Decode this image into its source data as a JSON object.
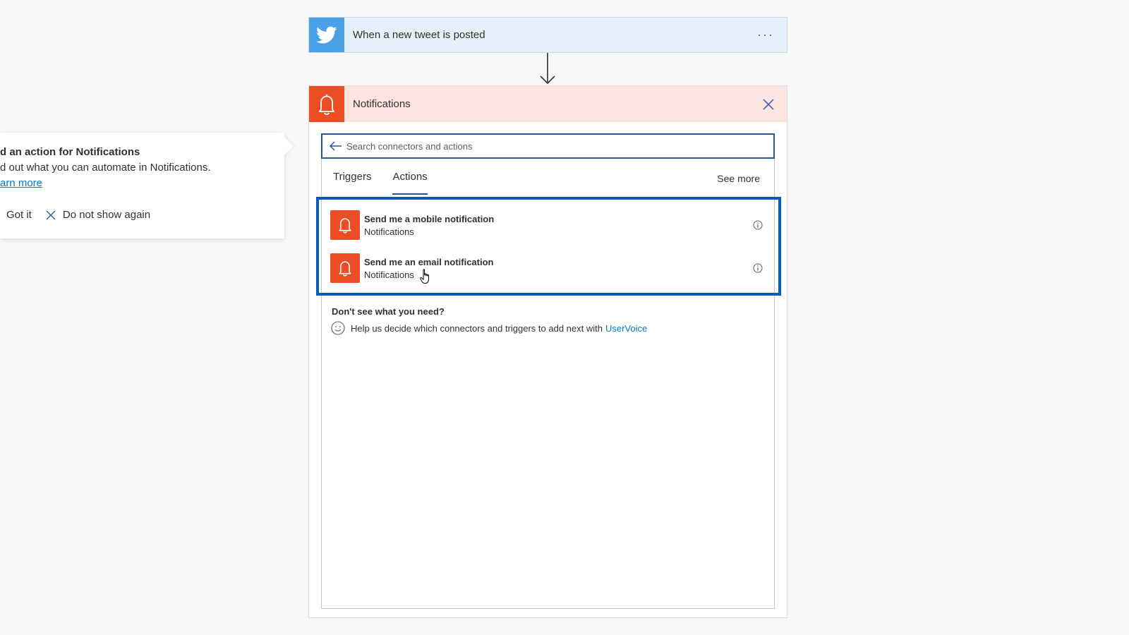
{
  "callout": {
    "title": "d an action for Notifications",
    "body": "d out what you can automate in Notifications.",
    "learn_more": "arn more",
    "got_it": "Got it",
    "do_not_show": "Do not show again"
  },
  "trigger": {
    "title": "When a new tweet is posted",
    "icon": "twitter-bird-icon",
    "more_label": "···"
  },
  "notifications": {
    "title": "Notifications",
    "icon": "bell-icon",
    "search": {
      "placeholder": "Search connectors and actions"
    },
    "tabs": [
      {
        "label": "Triggers",
        "active": false
      },
      {
        "label": "Actions",
        "active": true
      }
    ],
    "see_more": "See more",
    "actions": [
      {
        "title": "Send me a mobile notification",
        "subtitle": "Notifications"
      },
      {
        "title": "Send me an email notification",
        "subtitle": "Notifications"
      }
    ],
    "help": {
      "title": "Don't see what you need?",
      "text": "Help us decide which connectors and triggers to add next with",
      "link": "UserVoice"
    }
  },
  "colors": {
    "twitter": "#4aa0e6",
    "notification_accent": "#eb4d25",
    "highlight_border": "#0a58c2",
    "link": "#0078d4"
  }
}
